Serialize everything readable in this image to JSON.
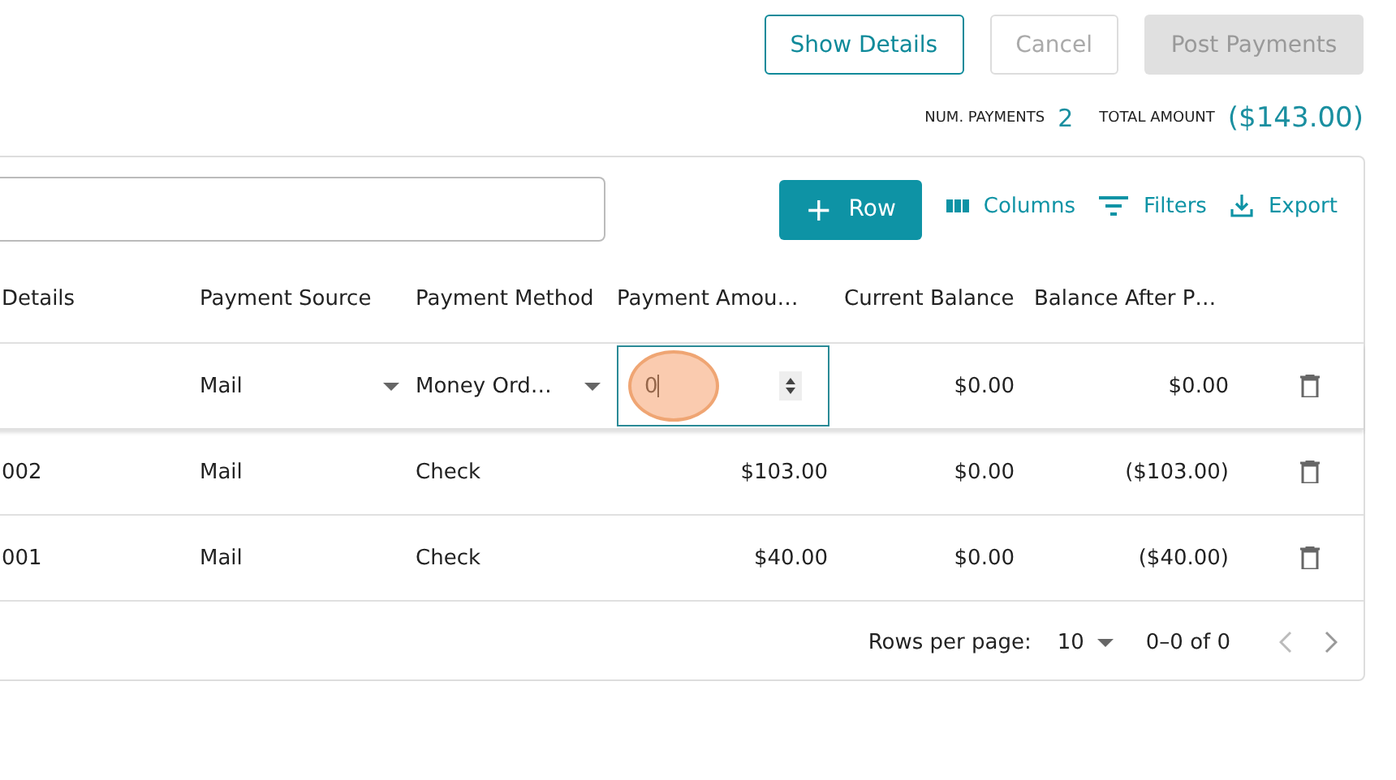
{
  "actions": [
    {
      "label": "Show Details",
      "kind": "outline",
      "disabled": false
    },
    {
      "label": "Cancel",
      "kind": "outline",
      "disabled": true
    },
    {
      "label": "Post Payments",
      "kind": "filled",
      "disabled": true
    }
  ],
  "summary": [
    {
      "label": "NUM. PAYMENTS",
      "value": "2"
    },
    {
      "label": "TOTAL AMOUNT",
      "value": "($143.00)"
    }
  ],
  "toolbar": {
    "add_button": "Row",
    "plus": "+",
    "buttons": [
      {
        "label": "Columns",
        "kind": "columns"
      },
      {
        "label": "Filters",
        "kind": "filters"
      },
      {
        "label": "Export",
        "kind": "export"
      }
    ]
  },
  "table": {
    "columns": [
      "Details",
      "Payment Source",
      "Payment Method",
      "Payment Amou…",
      "Current Balance",
      "Balance After P…"
    ],
    "edit_row": {
      "source": "Mail",
      "method": "Money Ord…",
      "amount": "0",
      "current": "$0.00",
      "after": "$0.00"
    },
    "rows": [
      {
        "details": "002",
        "source": "Mail",
        "method": "Check",
        "amount": "$103.00",
        "current": "$0.00",
        "after": "($103.00)"
      },
      {
        "details": "001",
        "source": "Mail",
        "method": "Check",
        "amount": "$40.00",
        "current": "$0.00",
        "after": "($40.00)"
      }
    ]
  },
  "pagination": {
    "rows_per_page_label": "Rows per page:",
    "rows_per_page": "10",
    "range": "0–0 of 0"
  }
}
